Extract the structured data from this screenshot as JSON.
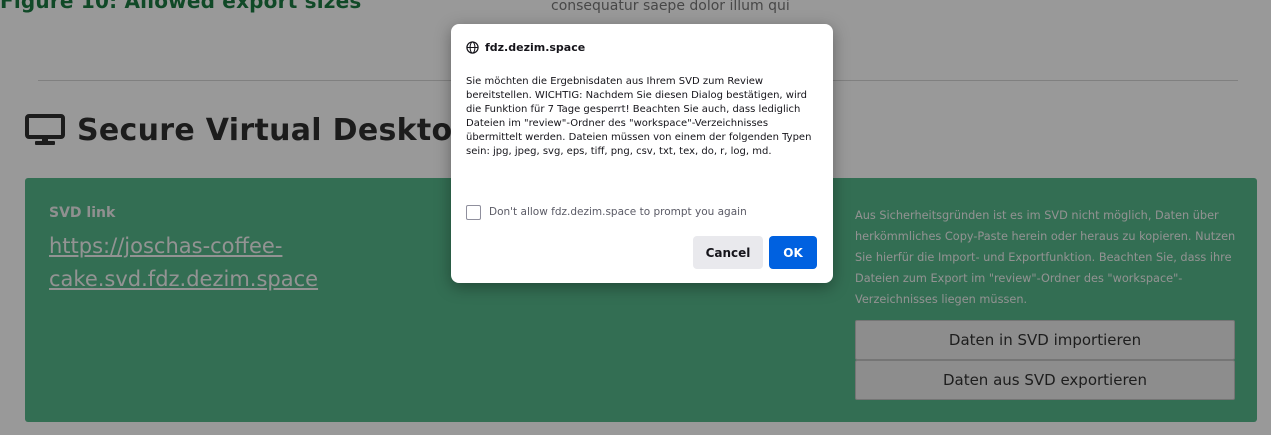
{
  "background": {
    "figure_title": "Figure 10: Allowed export sizes",
    "top_text": "consequatur saepe dolor illum qui",
    "section_heading": "Secure Virtual Desktop",
    "section_icon": "desktop-monitor-icon",
    "card": {
      "color": "#55b88a",
      "link_label": "SVD link",
      "link_text": "https://joschas-coffee-cake.svd.fdz.dezim.space",
      "info_text": "Aus Sicherheitsgründen ist es im SVD nicht möglich, Daten über herkömmliches Copy-Paste herein oder heraus zu kopieren. Nutzen Sie hierfür die Import- und Exportfunktion. Beachten Sie, dass ihre Dateien zum Export im \"review\"-Ordner des \"workspace\"-Verzeichnisses liegen müssen.",
      "import_button": "Daten in SVD importieren",
      "export_button": "Daten aus SVD exportieren"
    }
  },
  "dialog": {
    "origin_icon": "globe-icon",
    "origin": "fdz.dezim.space",
    "message": "Sie möchten die Ergebnisdaten aus Ihrem SVD zum Review bereitstellen. WICHTIG: Nachdem Sie diesen Dialog bestätigen, wird die Funktion für 7 Tage gesperrt! Beachten Sie auch, dass lediglich Dateien im \"review\"-Ordner des \"workspace\"-Verzeichnisses übermittelt werden. Dateien müssen von einem der folgenden Typen sein: jpg, jpeg, svg, eps, tiff, png, csv, txt, tex, do, r, log, md.",
    "checkbox_label": "Don't allow fdz.dezim.space to prompt you again",
    "checkbox_checked": false,
    "cancel_label": "Cancel",
    "ok_label": "OK",
    "ok_color": "#0061e0"
  }
}
